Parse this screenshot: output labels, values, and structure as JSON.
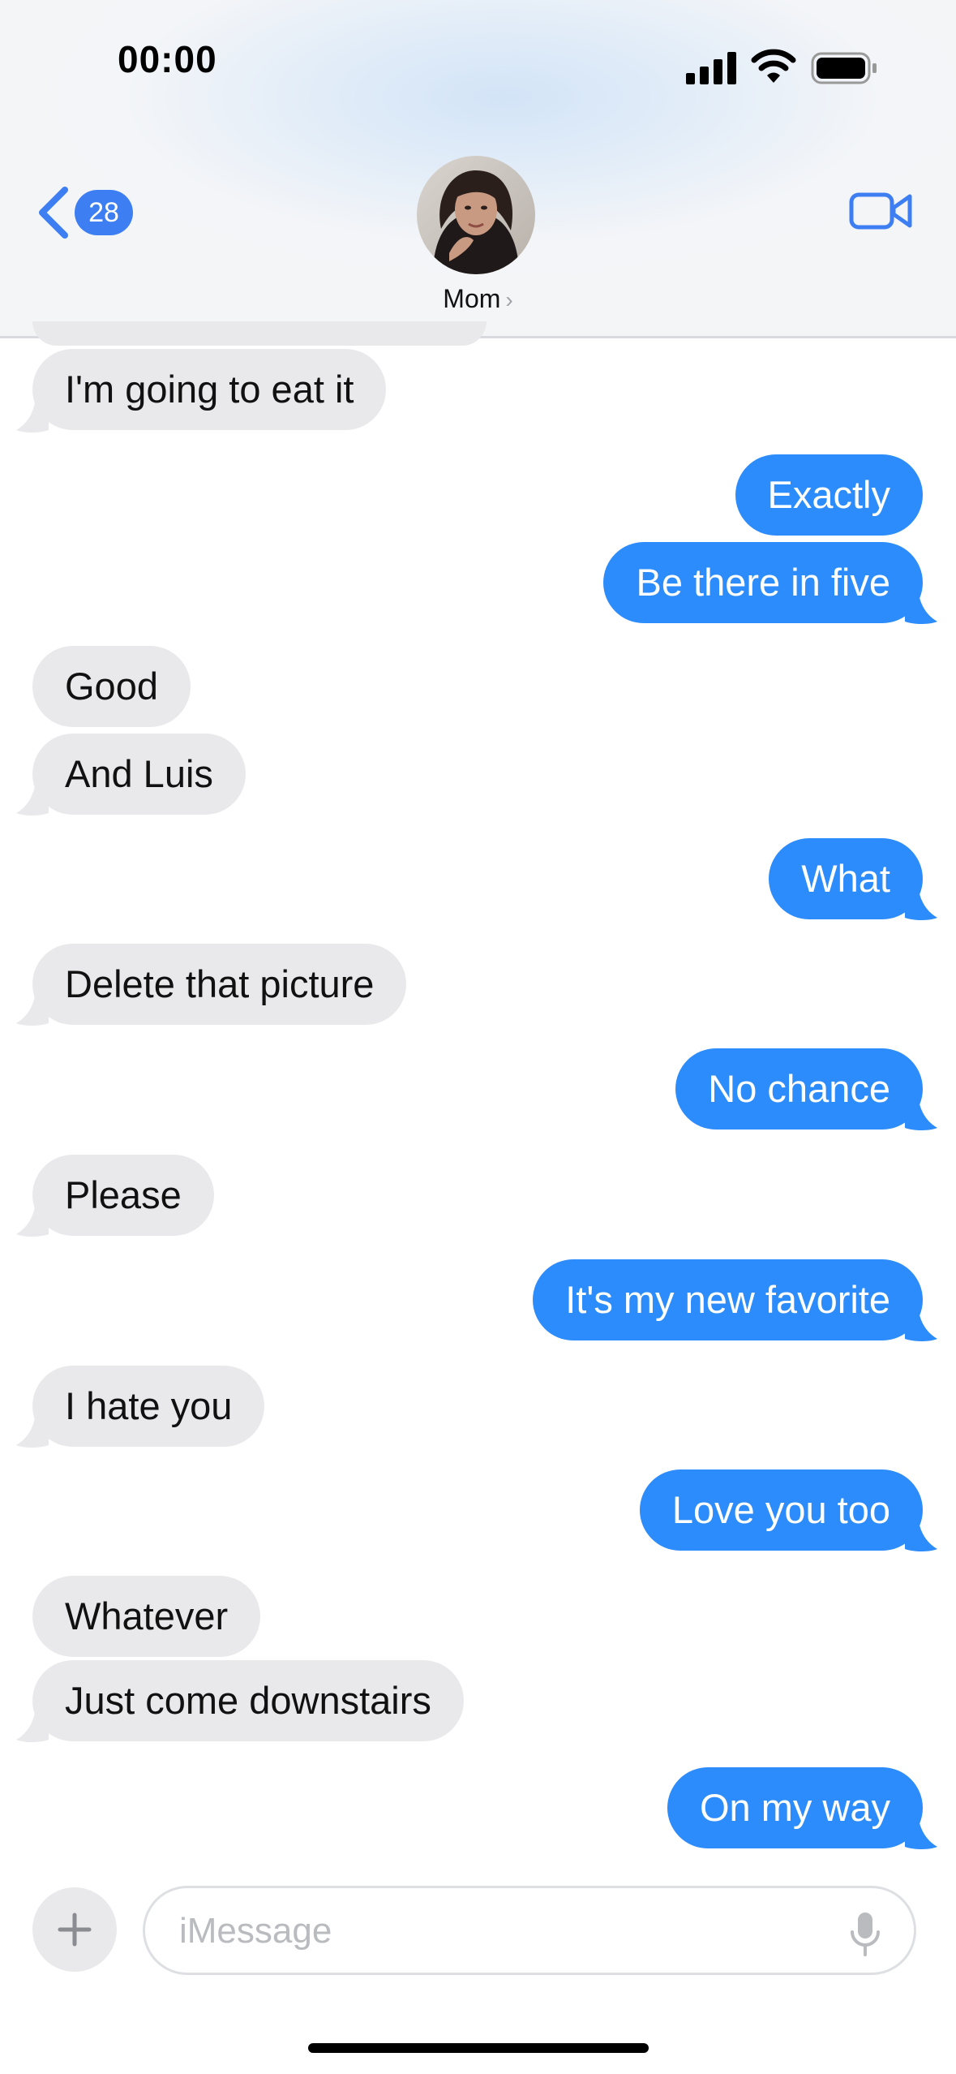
{
  "status_bar": {
    "time": "00:00"
  },
  "header": {
    "back_badge_count": "28",
    "contact_name": "Mom",
    "name_chevron": "›"
  },
  "messages": [
    {
      "direction": "incoming",
      "text": "I'm going to eat it"
    },
    {
      "direction": "outgoing",
      "text": "Exactly"
    },
    {
      "direction": "outgoing",
      "text": "Be there in five"
    },
    {
      "direction": "incoming",
      "text": "Good"
    },
    {
      "direction": "incoming",
      "text": "And Luis"
    },
    {
      "direction": "outgoing",
      "text": "What"
    },
    {
      "direction": "incoming",
      "text": "Delete that picture"
    },
    {
      "direction": "outgoing",
      "text": "No chance"
    },
    {
      "direction": "incoming",
      "text": "Please"
    },
    {
      "direction": "outgoing",
      "text": "It's my new favorite"
    },
    {
      "direction": "incoming",
      "text": "I hate you"
    },
    {
      "direction": "outgoing",
      "text": "Love you too"
    },
    {
      "direction": "incoming",
      "text": "Whatever"
    },
    {
      "direction": "incoming",
      "text": "Just come downstairs"
    },
    {
      "direction": "outgoing",
      "text": "On my way"
    }
  ],
  "composer": {
    "placeholder": "iMessage",
    "value": ""
  },
  "colors": {
    "outgoing_bubble": "#2d8cfb",
    "incoming_bubble": "#e9e9eb",
    "accent": "#3d7ff3"
  },
  "icons": [
    "signal-icon",
    "wifi-icon",
    "battery-icon",
    "back-chevron-icon",
    "video-call-icon",
    "plus-icon",
    "microphone-icon"
  ]
}
